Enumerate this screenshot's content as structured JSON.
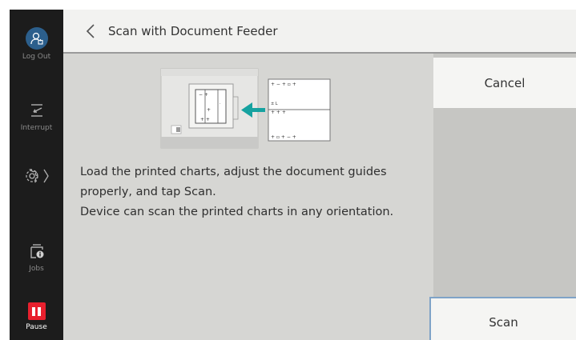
{
  "sidebar": {
    "logout_label": "Log Out",
    "interrupt_label": "Interrupt",
    "jobs_label": "Jobs",
    "pause_label": "Pause"
  },
  "header": {
    "title": "Scan with Document Feeder"
  },
  "content": {
    "instruction_line1": "Load the printed charts, adjust the document guides properly, and tap Scan.",
    "instruction_line2": "Device can scan the printed charts in any orientation."
  },
  "actions": {
    "cancel_label": "Cancel",
    "scan_label": "Scan"
  },
  "colors": {
    "sidebar_bg": "#1c1c1c",
    "avatar_bg": "#2c5f8c",
    "pause_red": "#e8202e",
    "arrow_teal": "#16a2a0",
    "scan_border": "#7fa3c7"
  }
}
